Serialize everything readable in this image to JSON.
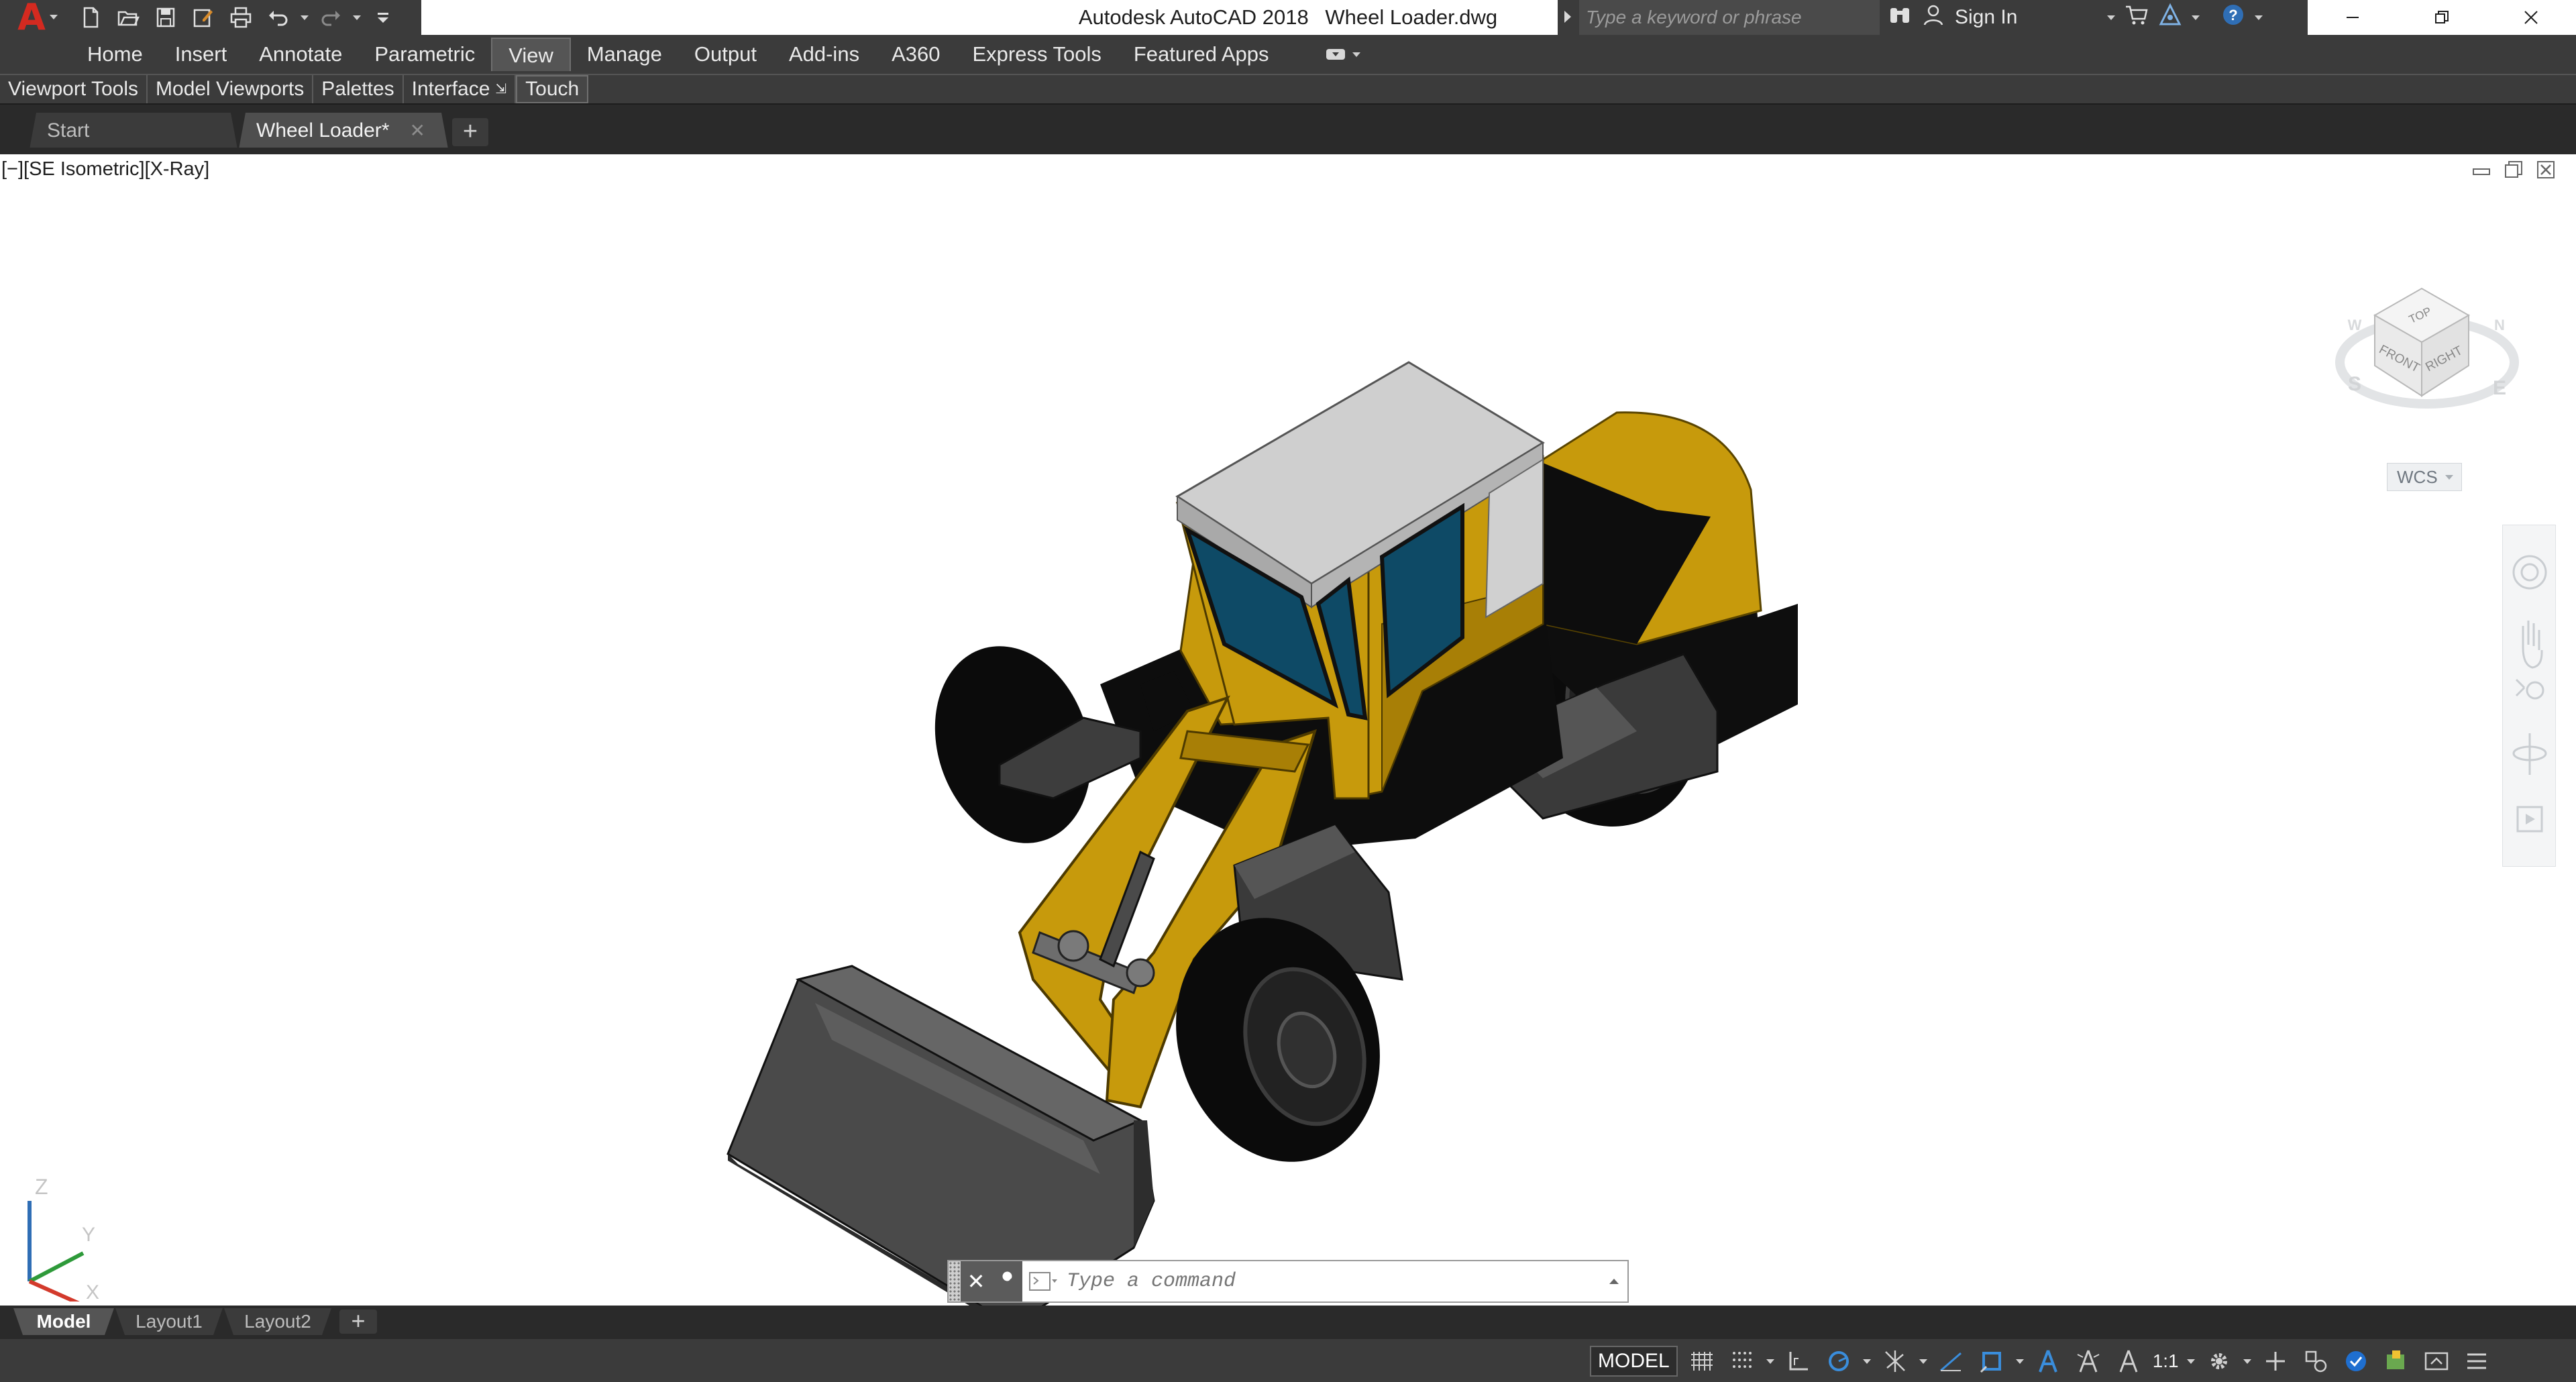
{
  "window": {
    "app_name": "Autodesk AutoCAD 2018",
    "file_name": "Wheel Loader.dwg",
    "search_placeholder": "Type a keyword or phrase",
    "sign_in_label": "Sign In"
  },
  "quick_access": [
    "new-icon",
    "open-icon",
    "save-icon",
    "save-as-icon",
    "plot-icon",
    "undo-icon",
    "redo-icon",
    "customize-icon"
  ],
  "ribbon": {
    "tabs": [
      "Home",
      "Insert",
      "Annotate",
      "Parametric",
      "View",
      "Manage",
      "Output",
      "Add-ins",
      "A360",
      "Express Tools",
      "Featured Apps"
    ],
    "active_tab": "View",
    "panels": [
      "Viewport Tools",
      "Model Viewports",
      "Palettes",
      "Interface",
      "Touch"
    ]
  },
  "file_tabs": {
    "start_label": "Start",
    "active_label": "Wheel Loader*"
  },
  "viewport": {
    "label": "[−][SE Isometric][X-Ray]",
    "viewcube": {
      "top": "TOP",
      "front": "FRONT",
      "right": "RIGHT",
      "compass_s": "S",
      "compass_e": "E",
      "compass_w": "W",
      "compass_n": "N"
    },
    "wcs_label": "WCS",
    "ucs": {
      "x": "X",
      "y": "Y",
      "z": "Z"
    }
  },
  "command_line": {
    "placeholder": "Type a command"
  },
  "layout_tabs": [
    "Model",
    "Layout1",
    "Layout2"
  ],
  "status_bar": {
    "model_label": "MODEL",
    "scale_label": "1:1"
  },
  "colors": {
    "body_yellow": "#c79a0c",
    "body_yellow_dark": "#a87f06",
    "glass": "#0e4a66",
    "roof": "#c8c8c8",
    "tire": "#0b0b0b",
    "bucket": "#4a4a4a",
    "accent_red": "#d42a20"
  }
}
